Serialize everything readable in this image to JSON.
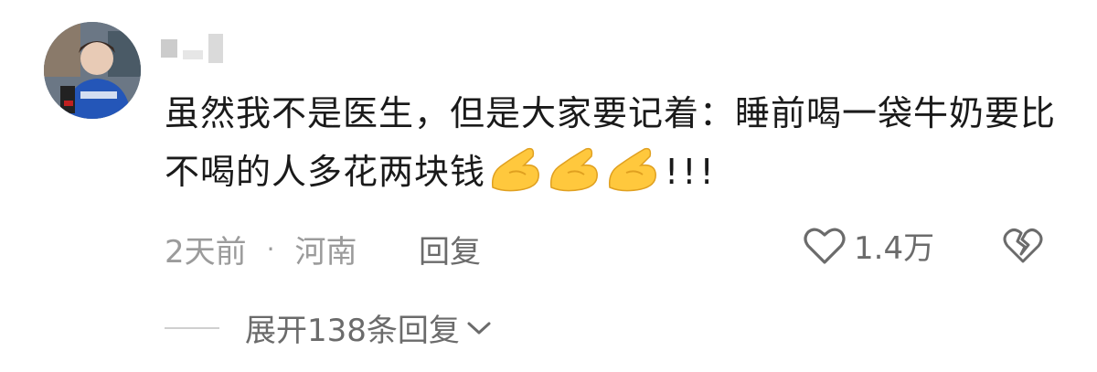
{
  "comment": {
    "text": "虽然我不是医生，但是大家要记着：睡前喝一袋牛奶要比不喝的人多花两块钱",
    "emoji": "pinched-fingers-icon",
    "emoji_count": 3,
    "suffix": "!!!"
  },
  "meta": {
    "time": "2天前",
    "separator": "·",
    "location": "河南",
    "reply_label": "回复"
  },
  "actions": {
    "like_icon": "heart-outline-icon",
    "like_count": "1.4万",
    "dislike_icon": "broken-heart-icon"
  },
  "expand": {
    "label": "展开138条回复",
    "icon": "chevron-down-icon"
  },
  "colors": {
    "text": "#1a1a1a",
    "meta": "#9b9b9b",
    "action": "#6b6b6b",
    "emoji": "#ffc83d"
  }
}
